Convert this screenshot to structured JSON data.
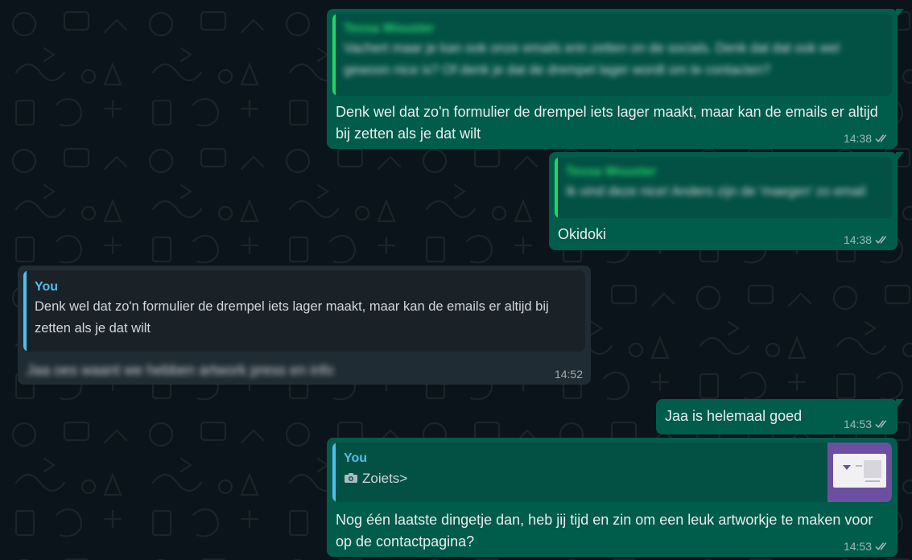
{
  "messages": [
    {
      "id": "m1",
      "direction": "out",
      "quote": {
        "author": "Tessa Wouster",
        "text": "Vachert maar je kan ook onze emails erin zetten on de socials. Denk dat dat ook wel gewoon nice is? Of denk je dat de drempel lager wordt om te contacten?"
      },
      "text": "Denk wel dat zo'n formulier de drempel iets lager maakt, maar kan de emails er altijd bij zetten als je dat wilt",
      "time": "14:38"
    },
    {
      "id": "m2",
      "direction": "out",
      "quote": {
        "author": "Tessa Wouster",
        "text": "Ik vind deze nice! Anders zijn de 'maegen' zo email"
      },
      "text": "Okidoki",
      "time": "14:38"
    },
    {
      "id": "m3",
      "direction": "in",
      "quote": {
        "author": "You",
        "text": "Denk wel dat zo'n formulier de drempel iets lager maakt, maar kan de emails er altijd bij zetten als je dat wilt"
      },
      "text": "Jaa oes waant we hebben artwork press en info",
      "time": "14:52"
    },
    {
      "id": "m4",
      "direction": "out",
      "text": "Jaa is helemaal goed",
      "time": "14:53"
    },
    {
      "id": "m5",
      "direction": "out",
      "quote": {
        "author": "You",
        "text": "Zoiets>"
      },
      "text": "Nog één laatste dingetje dan, heb jij tijd en zin om een leuk artworkje te maken voor op de contactpagina?",
      "time": "14:53"
    }
  ],
  "colors": {
    "background": "#0b141a",
    "outgoing_bubble": "#005c4b",
    "incoming_bubble": "#202c33",
    "quote_bar_green": "#25d366",
    "quote_bar_blue": "#53bdeb"
  },
  "icons": {
    "read_receipt": "double-check-icon",
    "photo": "camera-icon"
  }
}
